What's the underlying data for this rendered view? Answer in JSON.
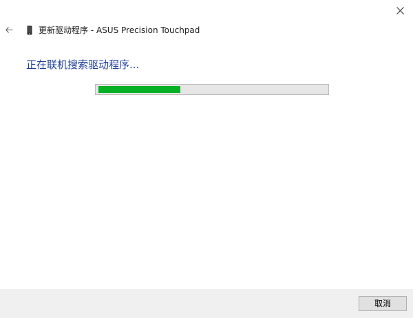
{
  "window": {
    "title": "更新驱动程序 - ASUS Precision Touchpad"
  },
  "status": {
    "heading": "正在联机搜索驱动程序..."
  },
  "progress": {
    "percent": 36,
    "fill_color": "#06b025"
  },
  "footer": {
    "cancel_label": "取消"
  },
  "icons": {
    "close": "close-icon",
    "back": "back-arrow-icon",
    "device": "device-icon"
  },
  "colors": {
    "heading": "#1f3f9a",
    "footer_bg": "#f0f0f0",
    "track": "#e6e6e6"
  }
}
